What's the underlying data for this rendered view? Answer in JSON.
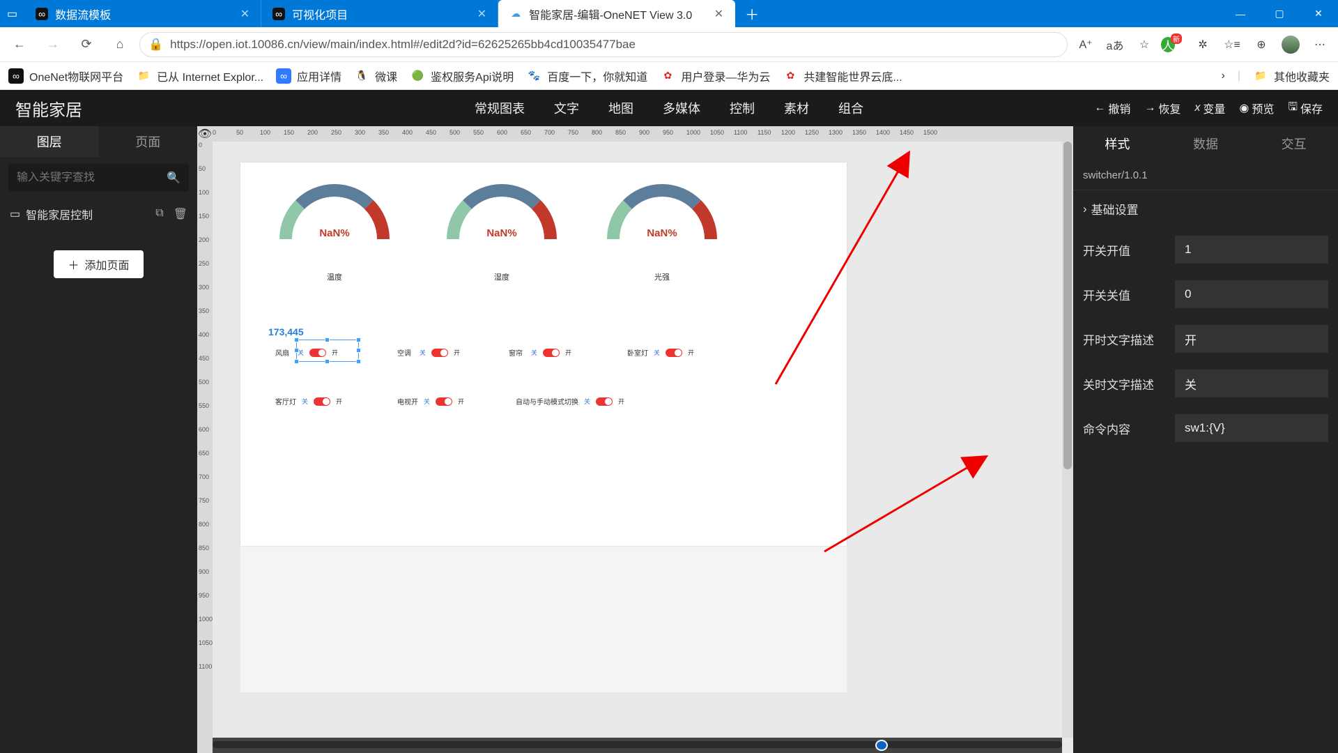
{
  "browser": {
    "tabs": [
      {
        "favicon": "∞",
        "title": "数据流模板"
      },
      {
        "favicon": "∞",
        "title": "可视化项目"
      },
      {
        "favicon": "☁",
        "title": "智能家居-编辑-OneNET View 3.0"
      }
    ],
    "active_tab": 2,
    "url": "https://open.iot.10086.cn/view/main/index.html#/edit2d?id=62625265bb4cd10035477bae",
    "bookmarks": [
      {
        "icon": "∞",
        "label": "OneNet物联网平台",
        "bg": "#111",
        "fg": "#fff"
      },
      {
        "icon": "📁",
        "label": "已从 Internet Explor..."
      },
      {
        "icon": "∞",
        "label": "应用详情",
        "bg": "#2f7bff",
        "fg": "#fff"
      },
      {
        "icon": "🐧",
        "label": "微课"
      },
      {
        "icon": "🟢",
        "label": "鉴权服务Api说明"
      },
      {
        "icon": "🐾",
        "label": "百度一下，你就知道"
      },
      {
        "icon": "✿",
        "label": "用户登录—华为云",
        "fg": "#d22"
      },
      {
        "icon": "✿",
        "label": "共建智能世界云底...",
        "fg": "#d22"
      }
    ],
    "bk_right": "其他收藏夹"
  },
  "app": {
    "title": "智能家居",
    "menu": [
      "常规图表",
      "文字",
      "地图",
      "多媒体",
      "控制",
      "素材",
      "组合"
    ],
    "actions": {
      "undo": "撤销",
      "redo": "恢复",
      "var": "变量",
      "preview": "预览",
      "save": "保存"
    }
  },
  "left": {
    "tabs": [
      "图层",
      "页面"
    ],
    "active": 0,
    "search_ph": "输入关键字查找",
    "item": "智能家居控制",
    "add": "添加页面"
  },
  "canvas": {
    "number": "173,445",
    "gauges": [
      {
        "value": "NaN%",
        "label": "温度"
      },
      {
        "value": "NaN%",
        "label": "湿度"
      },
      {
        "value": "NaN%",
        "label": "光强"
      }
    ],
    "gauge_ticks": [
      "0",
      "10",
      "20",
      "30",
      "40",
      "50",
      "60",
      "70",
      "80",
      "90",
      "100"
    ],
    "switch_off": "关",
    "switch_on": "开",
    "row1": [
      {
        "name": "风扇"
      },
      {
        "name": "空调"
      },
      {
        "name": "窗帘"
      },
      {
        "name": "卧室灯"
      }
    ],
    "row2": [
      {
        "name": "客厅灯"
      },
      {
        "name": "电视开"
      },
      {
        "name": "自动与手动模式切换"
      }
    ],
    "ruler_h": [
      "0",
      "50",
      "100",
      "150",
      "200",
      "250",
      "300",
      "350",
      "400",
      "450",
      "500",
      "550",
      "600",
      "650",
      "700",
      "750",
      "800",
      "850",
      "900",
      "950",
      "1000",
      "1050",
      "1100",
      "1150",
      "1200",
      "1250",
      "1300",
      "1350",
      "1400",
      "1450",
      "1500"
    ],
    "ruler_v": [
      "0",
      "50",
      "100",
      "150",
      "200",
      "250",
      "300",
      "350",
      "400",
      "450",
      "500",
      "550",
      "600",
      "650",
      "700",
      "750",
      "800",
      "850",
      "900",
      "950",
      "1000",
      "1050",
      "1100"
    ]
  },
  "right": {
    "tabs": [
      "样式",
      "数据",
      "交互"
    ],
    "active": 0,
    "component": "switcher/1.0.1",
    "section": "基础设置",
    "fields": {
      "on_value": {
        "label": "开关开值",
        "value": "1"
      },
      "off_value": {
        "label": "开关关值",
        "value": "0"
      },
      "on_text": {
        "label": "开时文字描述",
        "value": "开"
      },
      "off_text": {
        "label": "关时文字描述",
        "value": "关"
      },
      "cmd": {
        "label": "命令内容",
        "value": "sw1:{V}"
      }
    }
  }
}
